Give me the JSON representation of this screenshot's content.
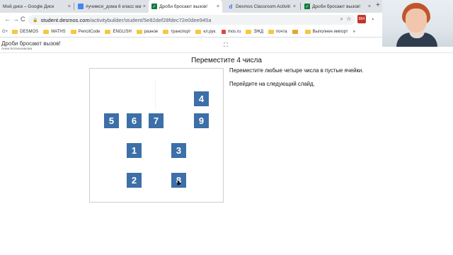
{
  "browser": {
    "tabs": [
      {
        "title": "Мой диск – Google Диск",
        "favicon": "google-drive-icon",
        "active": false
      },
      {
        "title": "#учимся_дома 6 класс мат",
        "favicon": "docs-icon",
        "active": false
      },
      {
        "title": "Дроби бросают вызов!",
        "favicon": "desmos-icon",
        "active": true
      },
      {
        "title": "Desmos Classroom Activiti",
        "favicon": "desmos-d-icon",
        "active": false
      },
      {
        "title": "Дроби бросают вызов!",
        "favicon": "desmos-icon",
        "active": false
      }
    ],
    "new_tab_label": "+",
    "close_glyph": "×",
    "nav": {
      "back": "←",
      "forward": "→",
      "reload": "C"
    },
    "url": {
      "host": "student.desmos.com",
      "path": "/activitybuilder/student/5e82def28fdec72e0dee945a"
    },
    "extension_badge": "864",
    "bookmarks": [
      "DESMOS",
      "MATHS",
      "PencilCode",
      "ENGLISH",
      "разное",
      "транспорт",
      "кл.рук.",
      "mos.ru",
      "ЭЖД",
      "почта",
      "",
      "Выполнен импорт"
    ],
    "bookmarks_more": "»"
  },
  "activity": {
    "title": "Дроби бросают вызов!",
    "author": "Анна Котельникова"
  },
  "slide": {
    "heading": "Переместите 4 числа",
    "instructions": [
      "Переместите любые четыре числа в пустые ячейки.",
      "Перейдите на следующий слайд."
    ],
    "tiles": [
      {
        "value": "4"
      },
      {
        "value": "5"
      },
      {
        "value": "6"
      },
      {
        "value": "7"
      },
      {
        "value": "9"
      },
      {
        "value": "1"
      },
      {
        "value": "3"
      },
      {
        "value": "2"
      },
      {
        "value": "8"
      }
    ]
  },
  "colors": {
    "tile": "#3d6fa8",
    "tab_strip": "#dee1e6",
    "omnibox": "#f1f3f4"
  }
}
